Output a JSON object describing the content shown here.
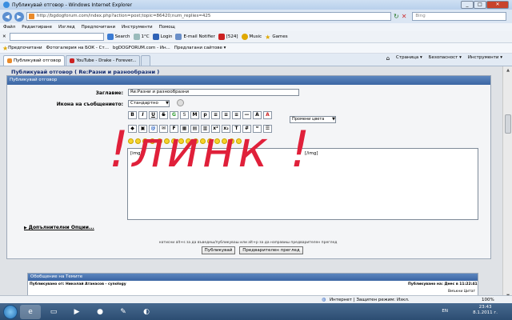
{
  "window": {
    "title": "Публикувай отговор - Windows Internet Explorer"
  },
  "address": {
    "url": "http://bgdogforum.com/index.php?action=post;topic=86420;num_replies=425",
    "search_placeholder": "Bing"
  },
  "menu": [
    "Файл",
    "Редактиране",
    "Изглед",
    "Предпочитани",
    "Инструменти",
    "Помощ"
  ],
  "toolbar2": {
    "search_label": "Search",
    "weather": "1°C",
    "login": "Login",
    "email": "E-mail Notifier",
    "count": "[524]",
    "music": "Music",
    "games": "Games"
  },
  "favorites": {
    "fav_label": "Предпочитани",
    "items": [
      "Фотогалерия на БОК - Ст...",
      "bgDOGFORUM.com - Ин...",
      "Предлагани сайтове ▾"
    ]
  },
  "tabs": [
    "Публикувай отговор",
    "YouTube - Drake - Forever..."
  ],
  "commands": [
    "Страница ▾",
    "Безопасност ▾",
    "Инструменти ▾"
  ],
  "page": {
    "heading": "Публикувай отговор ( Re:Разни и разнообразни )",
    "panel_title": "Публикувай отговор",
    "subject_label": "Заглавие:",
    "subject_value": "Re:Разни и разнообразни",
    "icon_label": "Икона на съобщението:",
    "icon_value": "Стандартно",
    "color_select": "Промени цвета",
    "message_img_open": "[img]",
    "message_img_close": "[/img]",
    "overlay_text": "!линк !",
    "more_options": "Допълнителни Опции...",
    "hint": "натисни alt+s за да въведеш/публикуваш или alt+p за да направиш предварителен преглед",
    "submit": "Публикувай",
    "preview": "Предварителен преглед"
  },
  "review": {
    "title": "Обобщение на Темите",
    "author": "Публикувано от: Николай Атанасов - cynology",
    "date": "Публикувано на: Днес в 11:22:41",
    "quote": "Вмъкни Цитат"
  },
  "status": {
    "zone": "Интернет | Защитен режим: Изкл.",
    "zoom": "100%"
  },
  "taskbar": {
    "lang": "EN",
    "time": "23:43",
    "date": "8.1.2011 г."
  },
  "icons": [
    "back-icon",
    "forward-icon",
    "refresh-icon",
    "stop-icon",
    "star-icon",
    "home-icon"
  ],
  "colors": {
    "accent": "#3b65a3",
    "overlay": "#e0203a"
  }
}
